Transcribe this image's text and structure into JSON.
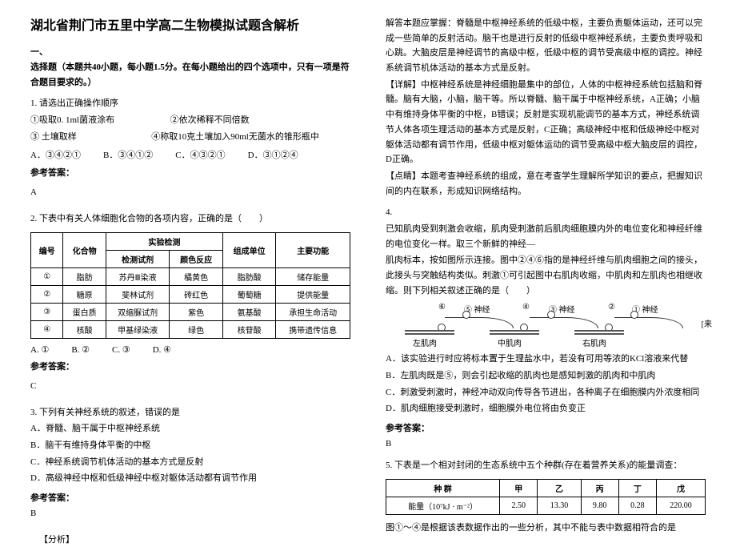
{
  "title": "湖北省荆门市五里中学高二生物模拟试题含解析",
  "sec1": {
    "n": "一、",
    "t": "选择题（本题共40小题，每小题1.5分。在每小题给出的四个选项中，只有一项是符合题目要求的。）"
  },
  "q1": {
    "stem": "1. 请选出正确操作顺序",
    "s1": "①吸取0. 1ml菌液涂布",
    "s2": "②依次稀释不同倍数",
    "s3": "③ 土壤取样",
    "s4": "④称取10克土壤加入90ml无菌水的锥形瓶中",
    "a": "A．③④②①",
    "b": "B．③④①②",
    "c": "C．④③②①",
    "d": "D．③①②④",
    "ansLabel": "参考答案：",
    "ans": "A"
  },
  "q2": {
    "stem": "2. 下表中有关人体细胞化合物的各项内容，正确的是（　　）",
    "h": {
      "c1": "编号",
      "c2": "化合物",
      "c3": "实验检测",
      "c3a": "检测试剂",
      "c3b": "颜色反应",
      "c4": "组成单位",
      "c5": "主要功能"
    },
    "r1": [
      "①",
      "脂肪",
      "苏丹Ⅲ染液",
      "橘黄色",
      "脂肪酸",
      "储存能量"
    ],
    "r2": [
      "②",
      "糖原",
      "斐林试剂",
      "砖红色",
      "葡萄糖",
      "提供能量"
    ],
    "r3": [
      "③",
      "蛋白质",
      "双缩脲试剂",
      "紫色",
      "氨基酸",
      "承担生命活动"
    ],
    "r4": [
      "④",
      "核酸",
      "甲基绿染液",
      "绿色",
      "核苷酸",
      "携带遗传信息"
    ],
    "a": "A. ①",
    "b": "B. ②",
    "c": "C. ③",
    "d": "D. ④",
    "ansLabel": "参考答案：",
    "ans": "C"
  },
  "q3": {
    "stem": "3. 下列有关神经系统的叙述，错误的是",
    "a": "A．脊髓、脑干属于中枢神经系统",
    "b": "B．脑干有维持身体平衡的中枢",
    "c": "C．神经系统调节机体活动的基本方式是反射",
    "d": "D．高级神经中枢和低级神经中枢对躯体活动都有调节作用",
    "ansLabel": "参考答案：",
    "ans": "B",
    "anaLabel": "【分析】"
  },
  "right": {
    "p1": "解答本题应掌握：脊髓是中枢神经系统的低级中枢，主要负责躯体运动，还可以完成一些简单的反射活动。脑干也是进行反射的低级中枢神经系统，主要负责呼吸和心跳。大脑皮层是神经调节的高级中枢，低级中枢的调节受高级中枢的调控。神经系统调节机体活动的基本方式是反射。",
    "p2": "【详解】中枢神经系统是神经细胞最集中的部位，人体的中枢神经系统包括脑和脊髓。脑有大脑，小脑，脑干等。所以脊髓、脑干属于中枢神经系统，A正确；小脑中有维持身体平衡的中枢，B错误；反射是实现机能调节的基本方式，神经系统调节人体各项生理活动的基本方式是反射，C正确；高级神经中枢和低级神经中枢对躯体活动都有调节作用，低级中枢对躯体运动的调节受高级中枢大脑皮层的调控，D正确。",
    "p3": "【点睛】本题考查神经系统的组成，意在考查学生理解所学知识的要点，把握知识间的内在联系，形成知识网络结构。",
    "q4n": "4.",
    "q4a": "已知肌肉受到刺激会收缩，肌肉受刺激前后肌肉细胞膜内外的电位变化和神经纤维的电位变化一样。取三个新鲜的神经—",
    "q4b": "肌肉标本，按如图所示连接。图中②④⑥指的是神经纤维与肌肉细胞之间的接头，此接头与突触结构类似。刺激①可引起图中右肌肉收缩，中肌肉和左肌肉也相继收缩。则下列相关叙述正确的是（　　）",
    "dia": {
      "c6": "⑥",
      "c5": "⑤ 神经",
      "c4": "④",
      "c3": "③ 神经",
      "c2": "②",
      "c1": "① 神经",
      "m1": "左肌肉",
      "m2": "中肌肉",
      "m3": "右肌肉",
      "lai": "[来"
    },
    "oa": "A．该实验进行时应将标本置于生理盐水中，若没有可用等浓的KCl溶液来代替",
    "ob": "B．左肌肉既是⑤，则会引起收缩的肌肉也是感知刺激的肌肉和中肌肉",
    "oc": "C．刺激受刺激时，神经冲动双向传导各节进出，各种离子在细胞膜内外浓度相同",
    "od": "D．肌肉细胞接受刺激时，细胞膜外电位将由负变正",
    "ansLabel": "参考答案：",
    "ans": "B",
    "q5": "5. 下表是一个相对封闭的生态系统中五个种群(存在着营养关系)的能量调查：",
    "t2h": [
      "种   群",
      "甲",
      "乙",
      "丙",
      "丁",
      "戊"
    ],
    "t2r": [
      "能量（10⁷kJ · m⁻²）",
      "2.50",
      "13.30",
      "9.80",
      "0.28",
      "220.00"
    ],
    "q5b": "图①～④是根据该表数据作出的一些分析，其中不能与表中数据相符合的是"
  }
}
